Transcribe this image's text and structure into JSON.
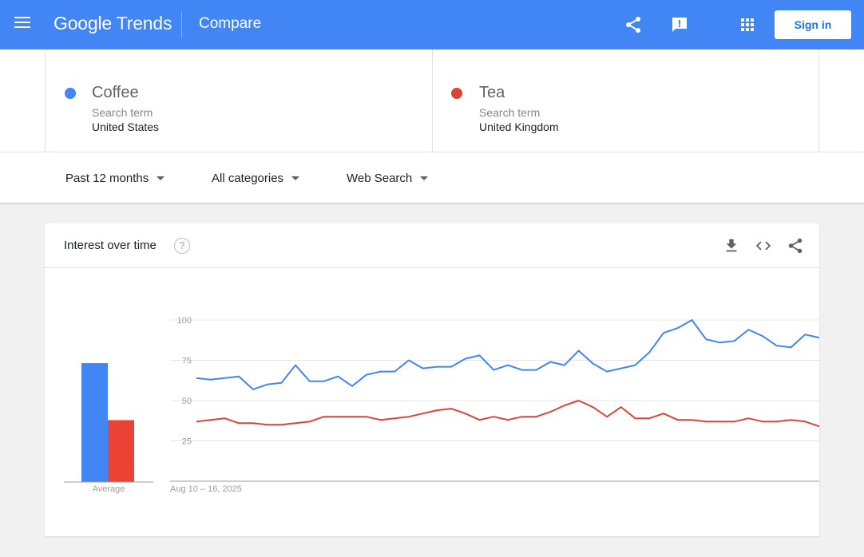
{
  "header": {
    "logo_google": "Google",
    "logo_trends": "Trends",
    "page_title": "Compare",
    "signin_label": "Sign in",
    "icons": [
      "menu-icon",
      "share-icon",
      "feedback-icon",
      "apps-icon"
    ],
    "bg_color": "#4285f4"
  },
  "terms": [
    {
      "name": "Coffee",
      "type": "Search term",
      "geo": "United States",
      "color": "#4285f4"
    },
    {
      "name": "Tea",
      "type": "Search term",
      "geo": "United Kingdom",
      "color": "#db4437"
    }
  ],
  "filters": {
    "time": "Past 12 months",
    "category": "All categories",
    "property": "Web Search"
  },
  "card": {
    "title": "Interest over time",
    "help": "?",
    "icons": [
      "download-icon",
      "embed-icon",
      "share-icon"
    ]
  },
  "chart_data": [
    {
      "type": "bar",
      "categories": [
        "Average"
      ],
      "series": [
        {
          "name": "Coffee",
          "values": [
            73
          ],
          "color": "#4285f4"
        },
        {
          "name": "Tea",
          "values": [
            38
          ],
          "color": "#ea4335"
        }
      ],
      "xlabel": "Average",
      "ylim": [
        0,
        100
      ]
    },
    {
      "type": "line",
      "x_start_label": "Aug 10 – 16, 2025",
      "yticks": [
        25,
        50,
        75,
        100
      ],
      "ylim": [
        0,
        100
      ],
      "grid": true,
      "series": [
        {
          "name": "Coffee",
          "color": "#4285f4",
          "values": [
            64,
            63,
            64,
            65,
            57,
            60,
            61,
            72,
            62,
            62,
            65,
            59,
            66,
            68,
            68,
            75,
            70,
            71,
            71,
            76,
            78,
            69,
            72,
            69,
            69,
            74,
            72,
            81,
            73,
            68,
            70,
            72,
            80,
            92,
            95,
            100,
            88,
            86,
            87,
            94,
            90,
            84,
            83,
            91,
            89
          ]
        },
        {
          "name": "Tea",
          "color": "#db4437",
          "values": [
            37,
            38,
            39,
            36,
            36,
            35,
            35,
            36,
            37,
            40,
            40,
            40,
            40,
            38,
            39,
            40,
            42,
            44,
            45,
            42,
            38,
            40,
            38,
            40,
            40,
            43,
            47,
            50,
            46,
            40,
            46,
            39,
            39,
            42,
            38,
            38,
            37,
            37,
            37,
            39,
            37,
            37,
            38,
            37,
            34
          ]
        }
      ]
    }
  ]
}
